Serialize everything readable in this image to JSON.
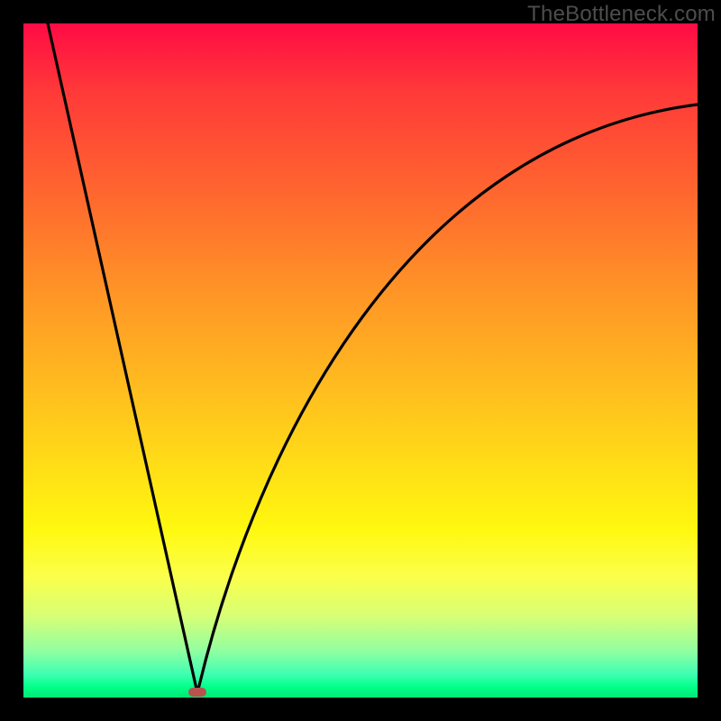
{
  "watermark": "TheBottleneck.com",
  "colors": {
    "marker": "#b6534e",
    "curve": "#000000"
  },
  "chart_data": {
    "type": "line",
    "title": "",
    "xlabel": "",
    "ylabel": "",
    "xlim": [
      0,
      1
    ],
    "ylim": [
      0,
      1
    ],
    "grid": false,
    "legend": false,
    "series": [
      {
        "name": "left-branch",
        "x": [
          0.036,
          0.083,
          0.13,
          0.18,
          0.22,
          0.248,
          0.258
        ],
        "values": [
          1.0,
          0.79,
          0.58,
          0.36,
          0.16,
          0.03,
          0.0
        ]
      },
      {
        "name": "right-branch",
        "x": [
          0.258,
          0.29,
          0.34,
          0.4,
          0.47,
          0.55,
          0.65,
          0.78,
          0.9,
          1.0
        ],
        "values": [
          0.0,
          0.14,
          0.33,
          0.5,
          0.63,
          0.73,
          0.8,
          0.85,
          0.87,
          0.88
        ]
      }
    ],
    "annotations": [
      {
        "name": "min-marker",
        "x": 0.258,
        "y": 0.0
      }
    ]
  }
}
